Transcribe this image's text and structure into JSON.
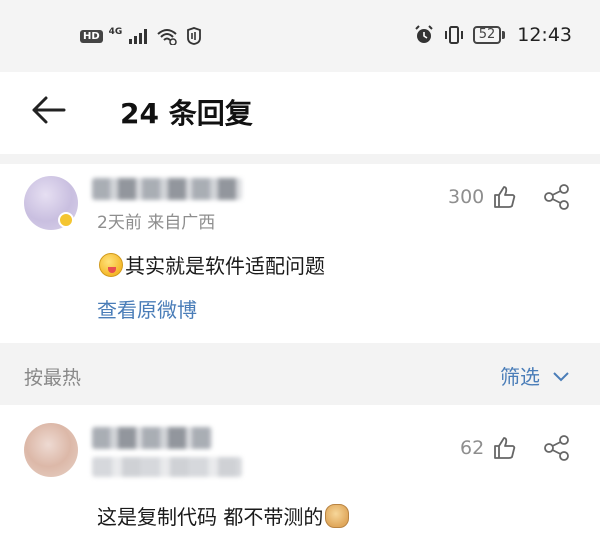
{
  "status_bar": {
    "hd": "HD",
    "network": "4G",
    "battery": "52",
    "time": "12:43",
    "icons": [
      "signal-icon",
      "wifi-icon",
      "nfc-icon",
      "alarm-icon",
      "vibrate-icon",
      "battery-icon"
    ]
  },
  "header": {
    "title": "24 条回复",
    "back_icon": "back-arrow-icon"
  },
  "main_comment": {
    "meta": "2天前  来自广西",
    "likes": "300",
    "text": "其实就是软件适配问题",
    "link": "查看原微博"
  },
  "sort_bar": {
    "label": "按最热",
    "filter_label": "筛选"
  },
  "replies": [
    {
      "likes": "62",
      "text": "这是复制代码 都不带测的"
    }
  ],
  "colors": {
    "link": "#4a7db8",
    "meta": "#8e8e8e",
    "divider_bg": "#f3f3f3"
  }
}
